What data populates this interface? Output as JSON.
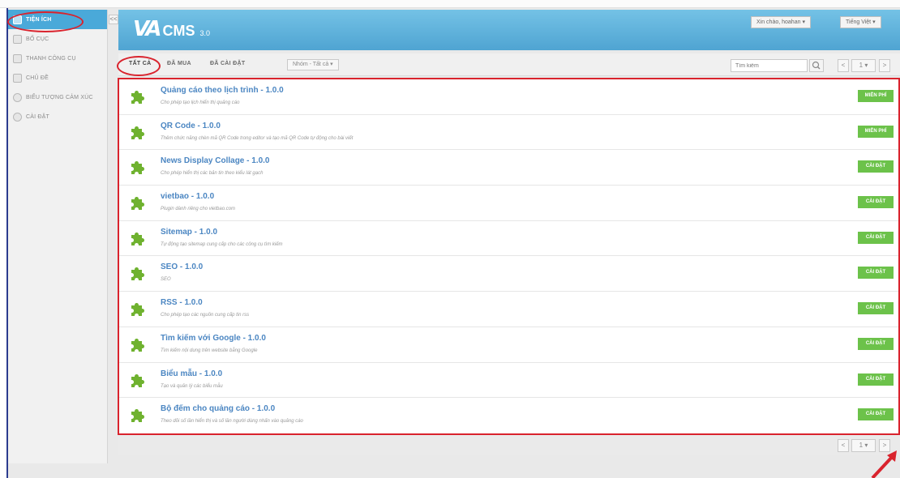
{
  "sidebar": {
    "items": [
      {
        "label": "TIỆN ÍCH",
        "icon": "plugin-icon",
        "active": true
      },
      {
        "label": "BỐ CỤC",
        "icon": "layout-icon",
        "active": false
      },
      {
        "label": "THANH CÔNG CỤ",
        "icon": "toolbar-icon",
        "active": false
      },
      {
        "label": "CHỦ ĐỀ",
        "icon": "theme-icon",
        "active": false
      },
      {
        "label": "BIỂU TƯỢNG CẢM XÚC",
        "icon": "smiley-icon",
        "active": false
      },
      {
        "label": "CÀI ĐẶT",
        "icon": "gear-icon",
        "active": false
      }
    ],
    "collapse_label": "<<"
  },
  "header": {
    "logo_text": "CMS",
    "logo_version": "3.0",
    "greeting_dropdown": "Xin chào, hoahan",
    "language_dropdown": "Tiếng Việt",
    "brand_color": "#4fa4d2"
  },
  "toolbar": {
    "tabs": [
      "TẤT CẢ",
      "ĐÃ MUA",
      "ĐÃ CÀI ĐẶT"
    ],
    "filter_label": "Nhóm - Tất cả",
    "search_placeholder": "Tìm kiếm",
    "page_label": "1",
    "prev_label": "<",
    "next_label": ">"
  },
  "plugins": [
    {
      "title": "Quảng cáo theo lịch trình - 1.0.0",
      "desc": "Cho phép tạo lịch hiển thị quảng cáo",
      "action": "MIỄN PHÍ"
    },
    {
      "title": "QR Code - 1.0.0",
      "desc": "Thêm chức năng chèn mã QR Code trong editor và tạo mã QR Code tự động cho bài viết",
      "action": "MIỄN PHÍ"
    },
    {
      "title": "News Display Collage - 1.0.0",
      "desc": "Cho phép hiển thị các bản tin theo kiểu lát gạch",
      "action": "CÀI ĐẶT"
    },
    {
      "title": "vietbao - 1.0.0",
      "desc": "Plugin dành riêng cho vietbao.com",
      "action": "CÀI ĐẶT"
    },
    {
      "title": "Sitemap - 1.0.0",
      "desc": "Tự động tạo sitemap cung cấp cho các công cụ tìm kiếm",
      "action": "CÀI ĐẶT"
    },
    {
      "title": "SEO - 1.0.0",
      "desc": "SEO",
      "action": "CÀI ĐẶT"
    },
    {
      "title": "RSS - 1.0.0",
      "desc": "Cho phép tạo các nguồn cung cấp tin rss",
      "action": "CÀI ĐẶT"
    },
    {
      "title": "Tìm kiếm với Google - 1.0.0",
      "desc": "Tìm kiếm nội dung trên website bằng Google",
      "action": "CÀI ĐẶT"
    },
    {
      "title": "Biểu mẫu - 1.0.0",
      "desc": "Tạo và quản lý các biểu mẫu",
      "action": "CÀI ĐẶT"
    },
    {
      "title": "Bộ đếm cho quảng cáo - 1.0.0",
      "desc": "Theo dõi số lần hiển thị và số lần người dùng nhấn vào quảng cáo",
      "action": "CÀI ĐẶT"
    }
  ],
  "footer": {
    "page_label": "1",
    "prev_label": "<",
    "next_label": ">"
  },
  "colors": {
    "action_button": "#6cc24a",
    "annotation": "#d9232d",
    "title_link": "#4b86c2"
  }
}
